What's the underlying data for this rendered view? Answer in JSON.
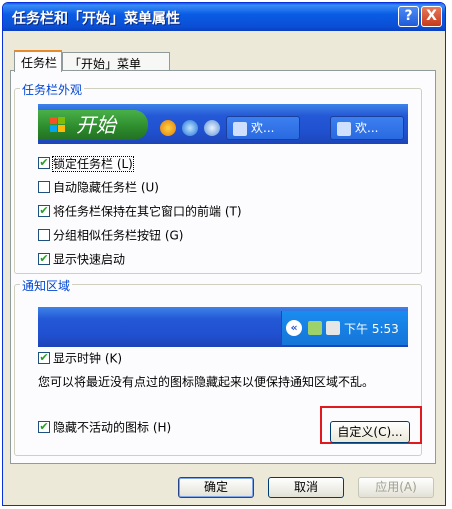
{
  "window": {
    "title": "任务栏和「开始」菜单属性"
  },
  "titlebar_buttons": {
    "help": "?",
    "close": "X"
  },
  "tabs": [
    {
      "label": "任务栏",
      "active": true
    },
    {
      "label": "「开始」菜单",
      "active": false
    }
  ],
  "taskbar_appearance": {
    "legend": "任务栏外观",
    "preview": {
      "start_label": "开始",
      "task_buttons": [
        "欢...",
        "欢..."
      ]
    },
    "options": [
      {
        "label": "锁定任务栏 (L)",
        "checked": true
      },
      {
        "label": "自动隐藏任务栏 (U)",
        "checked": false
      },
      {
        "label": "将任务栏保持在其它窗口的前端 (T)",
        "checked": true
      },
      {
        "label": "分组相似任务栏按钮 (G)",
        "checked": false
      },
      {
        "label": "显示快速启动",
        "checked": true
      }
    ]
  },
  "notification_area": {
    "legend": "通知区域",
    "tray": {
      "expand": "«",
      "clock": "下午 5:53"
    },
    "show_clock": {
      "label": "显示时钟 (K)",
      "checked": true
    },
    "info_text": "您可以将最近没有点过的图标隐藏起来以便保持通知区域不乱。",
    "hide_inactive": {
      "label": "隐藏不活动的图标 (H)",
      "checked": true
    },
    "customize_label": "自定义(C)..."
  },
  "buttons": {
    "ok": "确定",
    "cancel": "取消",
    "apply": "应用(A)"
  },
  "colors": {
    "titlebar": "#0a5ce5",
    "dialog_bg": "#ece9d8",
    "legend_text": "#0046d5",
    "highlight_box": "#e0191e"
  }
}
